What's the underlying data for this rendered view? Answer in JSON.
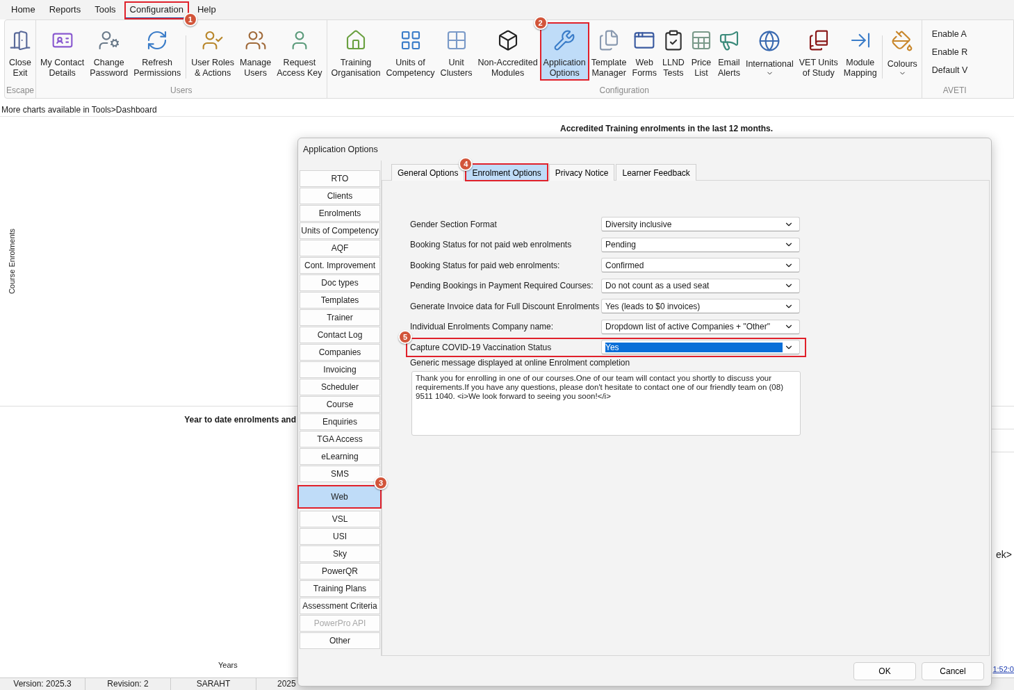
{
  "menu_tabs": [
    {
      "label": "Home",
      "selected": false
    },
    {
      "label": "Reports",
      "selected": false
    },
    {
      "label": "Tools",
      "selected": false
    },
    {
      "label": "Configuration",
      "selected": true,
      "callout": "1"
    },
    {
      "label": "Help",
      "selected": false
    }
  ],
  "ribbon": {
    "groups": [
      {
        "kind": "large",
        "label": "Escape",
        "buttons": [
          {
            "label": "Close\nExit",
            "selected": false
          }
        ]
      },
      {
        "kind": "large",
        "label": "Users",
        "buttons": [
          {
            "label": "My Contact\nDetails",
            "selected": false
          },
          {
            "label": "Change\nPassword",
            "selected": false
          },
          {
            "label": "Refresh\nPermissions",
            "selected": false
          },
          {
            "label": "User Roles\n& Actions",
            "selected": false,
            "separator_before": true
          },
          {
            "label": "Manage\nUsers",
            "selected": false
          },
          {
            "label": "Request\nAccess Key",
            "selected": false
          }
        ]
      },
      {
        "kind": "large",
        "label": "Configuration",
        "buttons": [
          {
            "label": "Training\nOrganisation",
            "selected": false
          },
          {
            "label": "Units of\nCompetency",
            "selected": false
          },
          {
            "label": "Unit\nClusters",
            "selected": false
          },
          {
            "label": "Non-Accredited\nModules",
            "selected": false
          },
          {
            "label": "Application\nOptions",
            "selected": true,
            "callout": "2"
          },
          {
            "label": "Template\nManager",
            "selected": false
          },
          {
            "label": "Web\nForms",
            "selected": false
          },
          {
            "label": "LLND\nTests",
            "selected": false
          },
          {
            "label": "Price\nList",
            "selected": false
          },
          {
            "label": "Email\nAlerts",
            "selected": false
          },
          {
            "label": "International",
            "selected": false,
            "dropdown": true
          },
          {
            "label": "VET Units\nof Study",
            "selected": false
          },
          {
            "label": "Module\nMapping",
            "selected": false
          },
          {
            "label": "Colours",
            "selected": false,
            "dropdown": true,
            "separator_before": true
          }
        ]
      },
      {
        "kind": "list",
        "label": "AVETI",
        "buttons": [
          {
            "label": "Enable A",
            "selected": false
          },
          {
            "label": "Enable R",
            "selected": false
          },
          {
            "label": "Default V",
            "selected": false
          }
        ]
      }
    ]
  },
  "info_bar": "More charts available in Tools>Dashboard",
  "background": {
    "top_chart_title": "Accredited Training enrolments in the last 12 months.",
    "top_ylabel": "Course Enrolments",
    "bottom_chart_title": "Year to date enrolments and",
    "bottom_xlabel": "Years",
    "right_text": "ek>",
    "right_link": "1:52:0"
  },
  "status_bar": [
    "Version: 2025.3",
    "Revision: 2",
    "SARAHT",
    "2025"
  ],
  "dialog": {
    "title": "Application Options",
    "nav": [
      {
        "label": "RTO",
        "selected": false,
        "disabled": false
      },
      {
        "label": "Clients",
        "selected": false,
        "disabled": false
      },
      {
        "label": "Enrolments",
        "selected": false,
        "disabled": false
      },
      {
        "label": "Units of Competency",
        "selected": false,
        "disabled": false
      },
      {
        "label": "AQF",
        "selected": false,
        "disabled": false
      },
      {
        "label": "Cont. Improvement",
        "selected": false,
        "disabled": false
      },
      {
        "label": "Doc types",
        "selected": false,
        "disabled": false
      },
      {
        "label": "Templates",
        "selected": false,
        "disabled": false
      },
      {
        "label": "Trainer",
        "selected": false,
        "disabled": false
      },
      {
        "label": "Contact Log",
        "selected": false,
        "disabled": false
      },
      {
        "label": "Companies",
        "selected": false,
        "disabled": false
      },
      {
        "label": "Invoicing",
        "selected": false,
        "disabled": false
      },
      {
        "label": "Scheduler",
        "selected": false,
        "disabled": false
      },
      {
        "label": "Course",
        "selected": false,
        "disabled": false
      },
      {
        "label": "Enquiries",
        "selected": false,
        "disabled": false
      },
      {
        "label": "TGA Access",
        "selected": false,
        "disabled": false
      },
      {
        "label": "eLearning",
        "selected": false,
        "disabled": false
      },
      {
        "label": "SMS",
        "selected": false,
        "disabled": false
      },
      {
        "label": "Web",
        "selected": true,
        "disabled": false,
        "callout": "3"
      },
      {
        "label": "VSL",
        "selected": false,
        "disabled": false
      },
      {
        "label": "USI",
        "selected": false,
        "disabled": false
      },
      {
        "label": "Sky",
        "selected": false,
        "disabled": false
      },
      {
        "label": "PowerQR",
        "selected": false,
        "disabled": false
      },
      {
        "label": "Training Plans",
        "selected": false,
        "disabled": false
      },
      {
        "label": "Assessment Criteria",
        "selected": false,
        "disabled": false
      },
      {
        "label": "PowerPro API",
        "selected": false,
        "disabled": true
      },
      {
        "label": "Other",
        "selected": false,
        "disabled": false
      }
    ],
    "tabs": [
      {
        "label": "General Options",
        "selected": false
      },
      {
        "label": "Enrolment Options",
        "selected": true,
        "callout": "4"
      },
      {
        "label": "Privacy Notice",
        "selected": false
      },
      {
        "label": "Learner Feedback",
        "selected": false
      }
    ],
    "fields": [
      {
        "label": "Gender Section Format",
        "value": "Diversity inclusive",
        "focused": false
      },
      {
        "label": "Booking Status for not paid web enrolments",
        "value": "Pending",
        "focused": false
      },
      {
        "label": "Booking Status for paid web enrolments:",
        "value": "Confirmed",
        "focused": false
      },
      {
        "label": "Pending Bookings in Payment Required Courses:",
        "value": "Do not count as a used seat",
        "focused": false
      },
      {
        "label": "Generate Invoice data for Full Discount Enrolments",
        "value": "Yes (leads to $0 invoices)",
        "focused": false
      },
      {
        "label": "Individual Enrolments Company name:",
        "value": "Dropdown list of active Companies + \"Other\"",
        "focused": false
      },
      {
        "label": "Capture COVID-19 Vaccination Status",
        "value": "Yes",
        "focused": true,
        "callout": "5"
      }
    ],
    "message": {
      "label": "Generic message displayed at online Enrolment completion",
      "value": "Thank you for enrolling in one of our courses.One of our team will contact you shortly to discuss your requirements.If you have any questions, please don't hesitate to contact one of our friendly team on (08) 9511 1040. <i>We look forward to seeing you soon!</i>"
    },
    "buttons": [
      "OK",
      "Cancel"
    ]
  }
}
